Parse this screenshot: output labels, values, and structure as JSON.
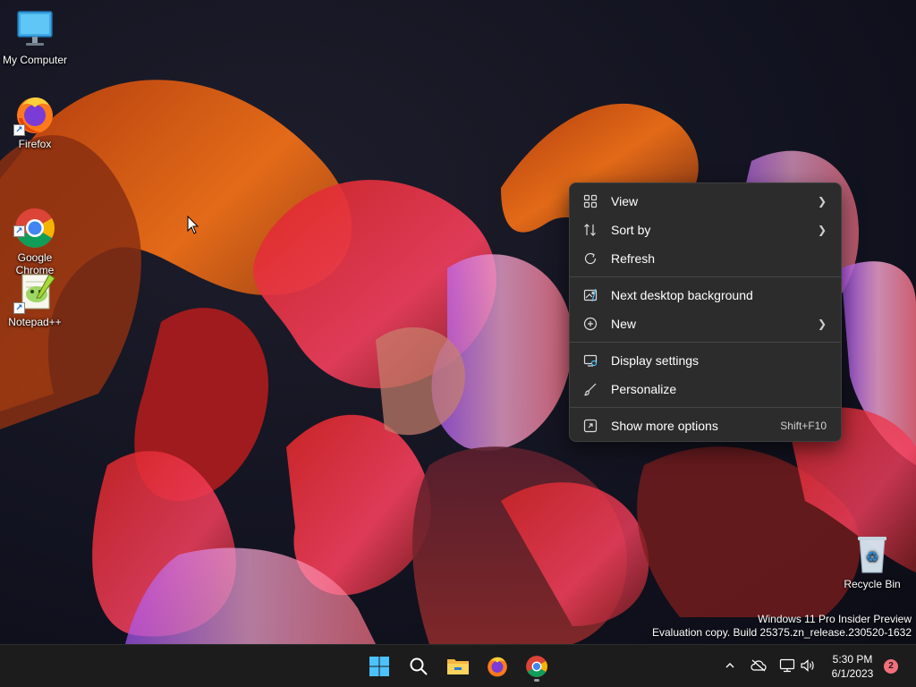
{
  "desktop": {
    "icons": [
      {
        "label": "My Computer"
      },
      {
        "label": "Firefox"
      },
      {
        "label": "Google\nChrome"
      },
      {
        "label": "Notepad++"
      },
      {
        "label": "Recycle Bin"
      }
    ]
  },
  "context_menu": {
    "items": [
      {
        "label": "View",
        "icon": "grid-icon",
        "submenu": true
      },
      {
        "label": "Sort by",
        "icon": "sort-icon",
        "submenu": true
      },
      {
        "label": "Refresh",
        "icon": "refresh-icon"
      },
      {
        "label": "Next desktop background",
        "icon": "next-background-icon"
      },
      {
        "label": "New",
        "icon": "plus-circle-icon",
        "submenu": true
      },
      {
        "label": "Display settings",
        "icon": "display-icon"
      },
      {
        "label": "Personalize",
        "icon": "brush-icon"
      },
      {
        "label": "Show more options",
        "icon": "more-options-icon",
        "shortcut": "Shift+F10"
      }
    ]
  },
  "watermark": {
    "line1": "Windows 11 Pro Insider Preview",
    "line2": "Evaluation copy. Build 25375.zn_release.230520-1632"
  },
  "taskbar": {
    "time": "5:30 PM",
    "date": "6/1/2023",
    "notification_count": "2",
    "accent_color": "#4cc2ff"
  }
}
